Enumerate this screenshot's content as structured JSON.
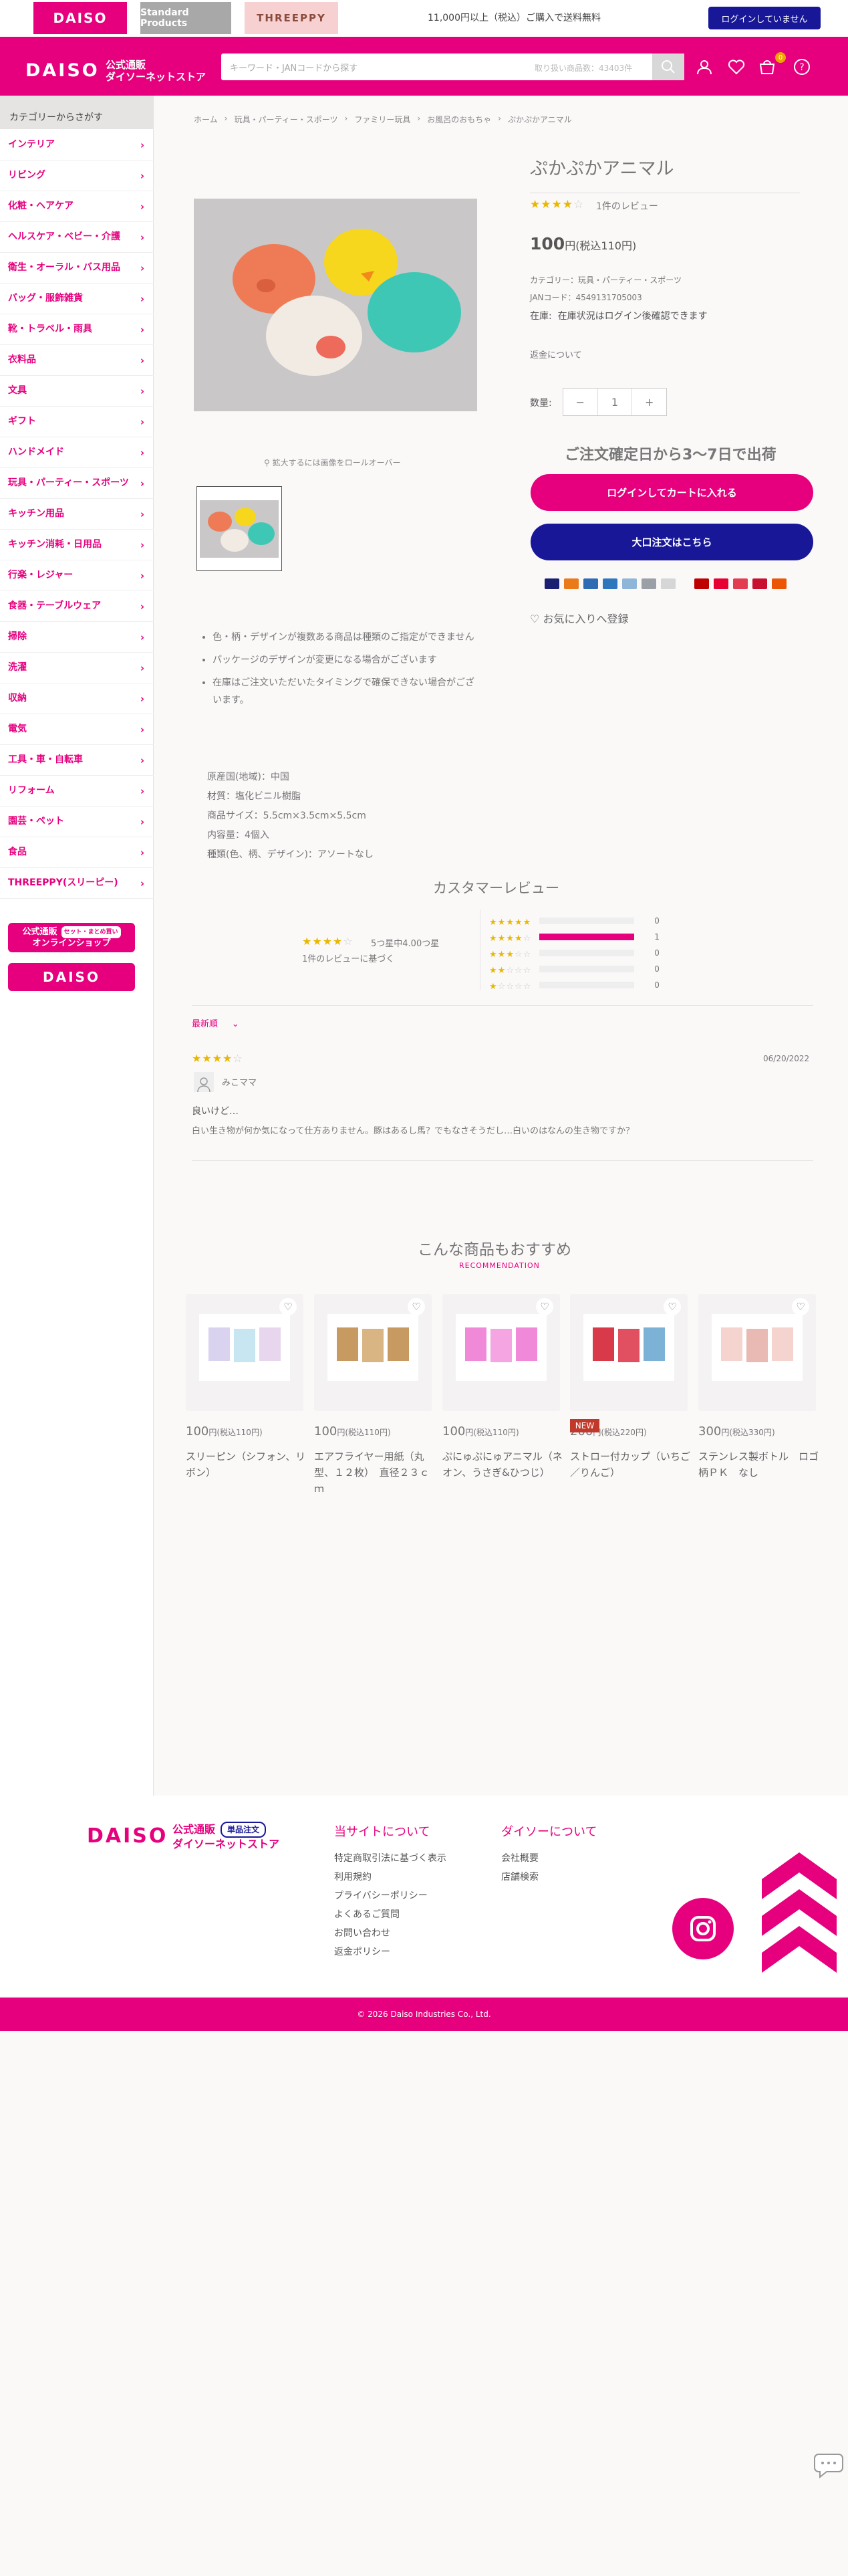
{
  "topbar": {
    "tabs": [
      {
        "label": "DAISO"
      },
      {
        "label": "Standard Products"
      },
      {
        "label": "THREEPPY"
      }
    ],
    "shipping_note": "11,000円以上（税込）ご購入で送料無料",
    "login_status": "ログインしていません"
  },
  "header": {
    "logo_text": "DAISO",
    "logo_sub_1": "公式通販",
    "logo_sub_2": "ダイソーネットストア",
    "search_placeholder": "キーワード・JANコードから探す",
    "search_hint": "取り扱い商品数：43403件",
    "cart_count": "0",
    "accent_color": "#e6007e",
    "navy_color": "#171797"
  },
  "sidebar": {
    "title": "カテゴリーからさがす",
    "items": [
      {
        "label": "インテリア"
      },
      {
        "label": "リビング"
      },
      {
        "label": "化粧・ヘアケア"
      },
      {
        "label": "ヘルスケア・ベビー・介護"
      },
      {
        "label": "衛生・オーラル・バス用品"
      },
      {
        "label": "バッグ・服飾雑貨"
      },
      {
        "label": "靴・トラベル・雨具"
      },
      {
        "label": "衣料品"
      },
      {
        "label": "文具"
      },
      {
        "label": "ギフト"
      },
      {
        "label": "ハンドメイド"
      },
      {
        "label": "玩具・パーティー・スポーツ"
      },
      {
        "label": "キッチン用品"
      },
      {
        "label": "キッチン消耗・日用品"
      },
      {
        "label": "行楽・レジャー"
      },
      {
        "label": "食器・テーブルウェア"
      },
      {
        "label": "掃除"
      },
      {
        "label": "洗濯"
      },
      {
        "label": "収納"
      },
      {
        "label": "電気"
      },
      {
        "label": "工具・車・自転車"
      },
      {
        "label": "リフォーム"
      },
      {
        "label": "園芸・ペット"
      },
      {
        "label": "食品"
      },
      {
        "label": "THREEPPY(スリーピー)"
      }
    ],
    "banner_online_1": "公式通販",
    "banner_online_badge": "セット・まとめ買い",
    "banner_online_2": "オンラインショップ",
    "banner_daiso": "DAISO"
  },
  "breadcrumb": [
    "ホーム",
    "玩具・パーティー・スポーツ",
    "ファミリー玩具",
    "お風呂のおもちゃ",
    "ぷかぷかアニマル"
  ],
  "product": {
    "title": "ぷかぷかアニマル",
    "rating": 4,
    "review_count": "1件のレビュー",
    "price": "100",
    "price_suffix": "円(税込110円)",
    "category": "カテゴリー：玩具・パーティー・スポーツ",
    "jan": "JANコード：4549131705003",
    "stock_label": "在庫:",
    "stock_value": "在庫状況はログイン後確認できます",
    "return_link": "返金について",
    "qty_label": "数量:",
    "qty_value": "1",
    "zoom_note": "拡大するには画像をロールオーバー",
    "ship_head": "ご注文確定日から3〜7日で出荷",
    "cart_button": "ログインしてカートに入れる",
    "bulk_button": "大口注文はこちら",
    "favorite": "お気に入りへ登録"
  },
  "description": {
    "notes": [
      "色・柄・デザインが複数ある商品は種類のご指定ができません",
      "パッケージのデザインが変更になる場合がございます",
      "在庫はご注文いただいたタイミングで確保できない場合がございます。"
    ],
    "specs": [
      "原産国(地域)：中国",
      "材質：塩化ビニル樹脂",
      "商品サイズ：5.5cm×3.5cm×5.5cm",
      "内容量：4個入",
      "種類(色、柄、デザイン)：アソートなし"
    ]
  },
  "reviews": {
    "title": "カスタマーレビュー",
    "average_text": "5つ星中4.00つ星",
    "basis_text": "1件のレビューに基づく",
    "distribution": [
      {
        "stars": 5,
        "count": "0",
        "fraction": 0
      },
      {
        "stars": 4,
        "count": "1",
        "fraction": 1
      },
      {
        "stars": 3,
        "count": "0",
        "fraction": 0
      },
      {
        "stars": 2,
        "count": "0",
        "fraction": 0
      },
      {
        "stars": 1,
        "count": "0",
        "fraction": 0
      }
    ],
    "sort_label": "最新順",
    "items": [
      {
        "rating": 4,
        "date": "06/20/2022",
        "author": "みこママ",
        "heading": "良いけど…",
        "body": "白い生き物が何か気になって仕方ありません。豚はあるし馬？でもなさそうだし…白いのはなんの生き物ですか？"
      }
    ]
  },
  "recommend": {
    "title": "こんな商品もおすすめ",
    "subtitle": "RECOMMENDATION",
    "items": [
      {
        "price": "100",
        "price_suffix": "円(税込110円)",
        "name": "スリーピン（シフォン、リボン）",
        "badge": ""
      },
      {
        "price": "100",
        "price_suffix": "円(税込110円)",
        "name": "エアフライヤー用紙（丸型、１２枚）　直径２３ｃｍ",
        "badge": ""
      },
      {
        "price": "100",
        "price_suffix": "円(税込110円)",
        "name": "ぷにゅぷにゅアニマル（ネオン、うさぎ&ひつじ）",
        "badge": ""
      },
      {
        "price": "200",
        "price_suffix": "円(税込220円)",
        "name": "ストロー付カップ（いちご／りんご）",
        "badge": "NEW"
      },
      {
        "price": "300",
        "price_suffix": "円(税込330円)",
        "name": "ステンレス製ボトル　ロゴ柄ＰＫ　なし",
        "badge": ""
      }
    ]
  },
  "footer": {
    "logo_text": "DAISO",
    "logo_sub_1": "公式通販",
    "logo_badge": "単品注文",
    "logo_sub_2": "ダイソーネットストア",
    "about_site_title": "当サイトについて",
    "about_site_links": [
      "特定商取引法に基づく表示",
      "利用規約",
      "プライバシーポリシー",
      "よくあるご質問",
      "お問い合わせ",
      "返金ポリシー"
    ],
    "about_daiso_title": "ダイソーについて",
    "about_daiso_links": [
      "会社概要",
      "店舗検索"
    ],
    "copyright": "© 2026 Daiso Industries Co., Ltd."
  }
}
